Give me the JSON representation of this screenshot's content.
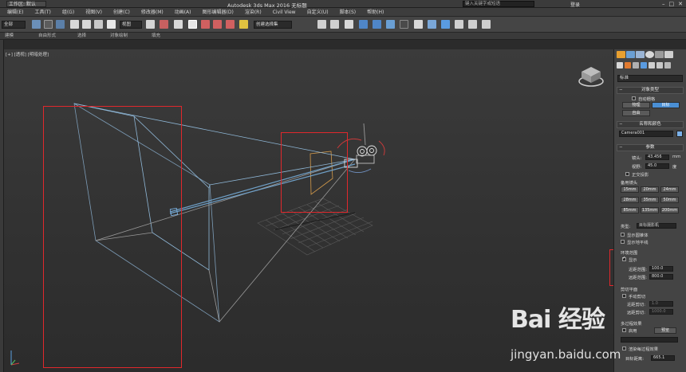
{
  "titlebar": {
    "workspace": "工作区: 默认",
    "app_title": "Autodesk 3ds Max 2016    无标题",
    "search_placeholder": "键入关键字或短语",
    "login": "登录"
  },
  "menubar": {
    "items": [
      "编辑(E)",
      "工具(T)",
      "组(G)",
      "视图(V)",
      "创建(C)",
      "修改器(M)",
      "动画(A)",
      "图形编辑器(D)",
      "渲染(R)",
      "Civil View",
      "自定义(U)",
      "脚本(S)",
      "帮助(H)"
    ]
  },
  "toolbar": {
    "selection_set": "全部",
    "ref_coord": "视图",
    "named_selection": "创建选择集"
  },
  "ribbon": {
    "items": [
      "建模",
      "自由形式",
      "选择",
      "对象绘制",
      "填充"
    ]
  },
  "viewport": {
    "label": "[+] [透视] [明暗处理]"
  },
  "command_panel": {
    "category_dropdown": "标准",
    "object_type": {
      "header": "对象类型",
      "auto_grid": "自动栅格",
      "buttons": [
        "物理",
        "目标",
        "自由"
      ]
    },
    "name_color": {
      "header": "名称和颜色",
      "name": "Camera001"
    },
    "params": {
      "header": "参数",
      "lens_label": "镜头:",
      "lens_value": "43.456",
      "lens_unit": "mm",
      "fov_label": "视野:",
      "fov_value": "45.0",
      "fov_unit": "度",
      "ortho": "正交投影",
      "stock_lenses": "备用镜头",
      "lenses": [
        "15mm",
        "20mm",
        "24mm",
        "28mm",
        "35mm",
        "50mm",
        "85mm",
        "135mm",
        "200mm"
      ],
      "type_label": "类型:",
      "type_value": "目标摄影机",
      "show_cone": "显示圆锥体",
      "show_horizon": "显示地平线"
    },
    "env_ranges": {
      "header": "环境范围",
      "show": "显示",
      "near_label": "近距范围:",
      "near_value": "100.0",
      "far_label": "远距范围:",
      "far_value": "800.0"
    },
    "clipping": {
      "header": "剪切平面",
      "manual": "手动剪切",
      "near_label": "近距剪切:",
      "near_value": "1.0",
      "far_label": "远距剪切:",
      "far_value": "1000.0"
    },
    "multipass": {
      "header": "多过程效果",
      "enable": "启用",
      "preview": "预览",
      "render_per_pass": "渲染每过程效果",
      "target_dist_label": "目标距离:",
      "target_dist_value": "665.1"
    }
  },
  "watermark": {
    "logo": "Bai 经验",
    "url": "jingyan.baidu.com"
  },
  "colors": {
    "highlight_box": "#e0282c",
    "wire": "#8fb8d8",
    "accent": "#4a8fd4"
  }
}
